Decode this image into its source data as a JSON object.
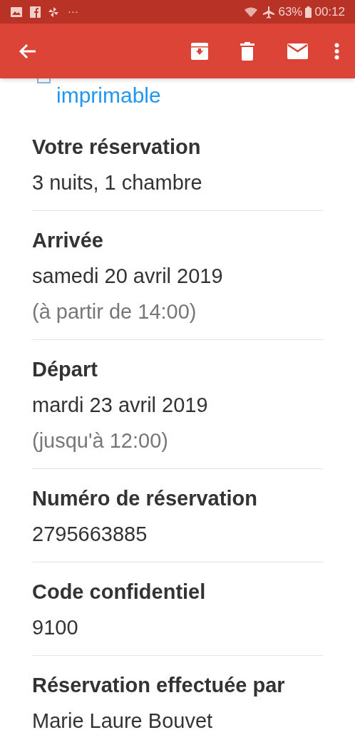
{
  "status_bar": {
    "more": "···",
    "battery": "63%",
    "time": "00:12"
  },
  "link": "imprimable",
  "sections": [
    {
      "title": "Votre réservation",
      "lines": [
        {
          "text": "3 nuits, 1 chambre",
          "kind": "value"
        }
      ]
    },
    {
      "title": "Arrivée",
      "lines": [
        {
          "text": "samedi 20 avril 2019",
          "kind": "value"
        },
        {
          "text": "(à partir de 14:00)",
          "kind": "note"
        }
      ]
    },
    {
      "title": "Départ",
      "lines": [
        {
          "text": "mardi 23 avril 2019",
          "kind": "value"
        },
        {
          "text": "(jusqu'à 12:00)",
          "kind": "note"
        }
      ]
    },
    {
      "title": "Numéro de réservation",
      "lines": [
        {
          "text": "2795663885",
          "kind": "value"
        }
      ]
    },
    {
      "title": "Code confidentiel",
      "lines": [
        {
          "text": "9100",
          "kind": "value"
        }
      ]
    },
    {
      "title": "Réservation effectuée par",
      "lines": [
        {
          "text": "Marie Laure Bouvet",
          "kind": "value"
        }
      ]
    }
  ]
}
